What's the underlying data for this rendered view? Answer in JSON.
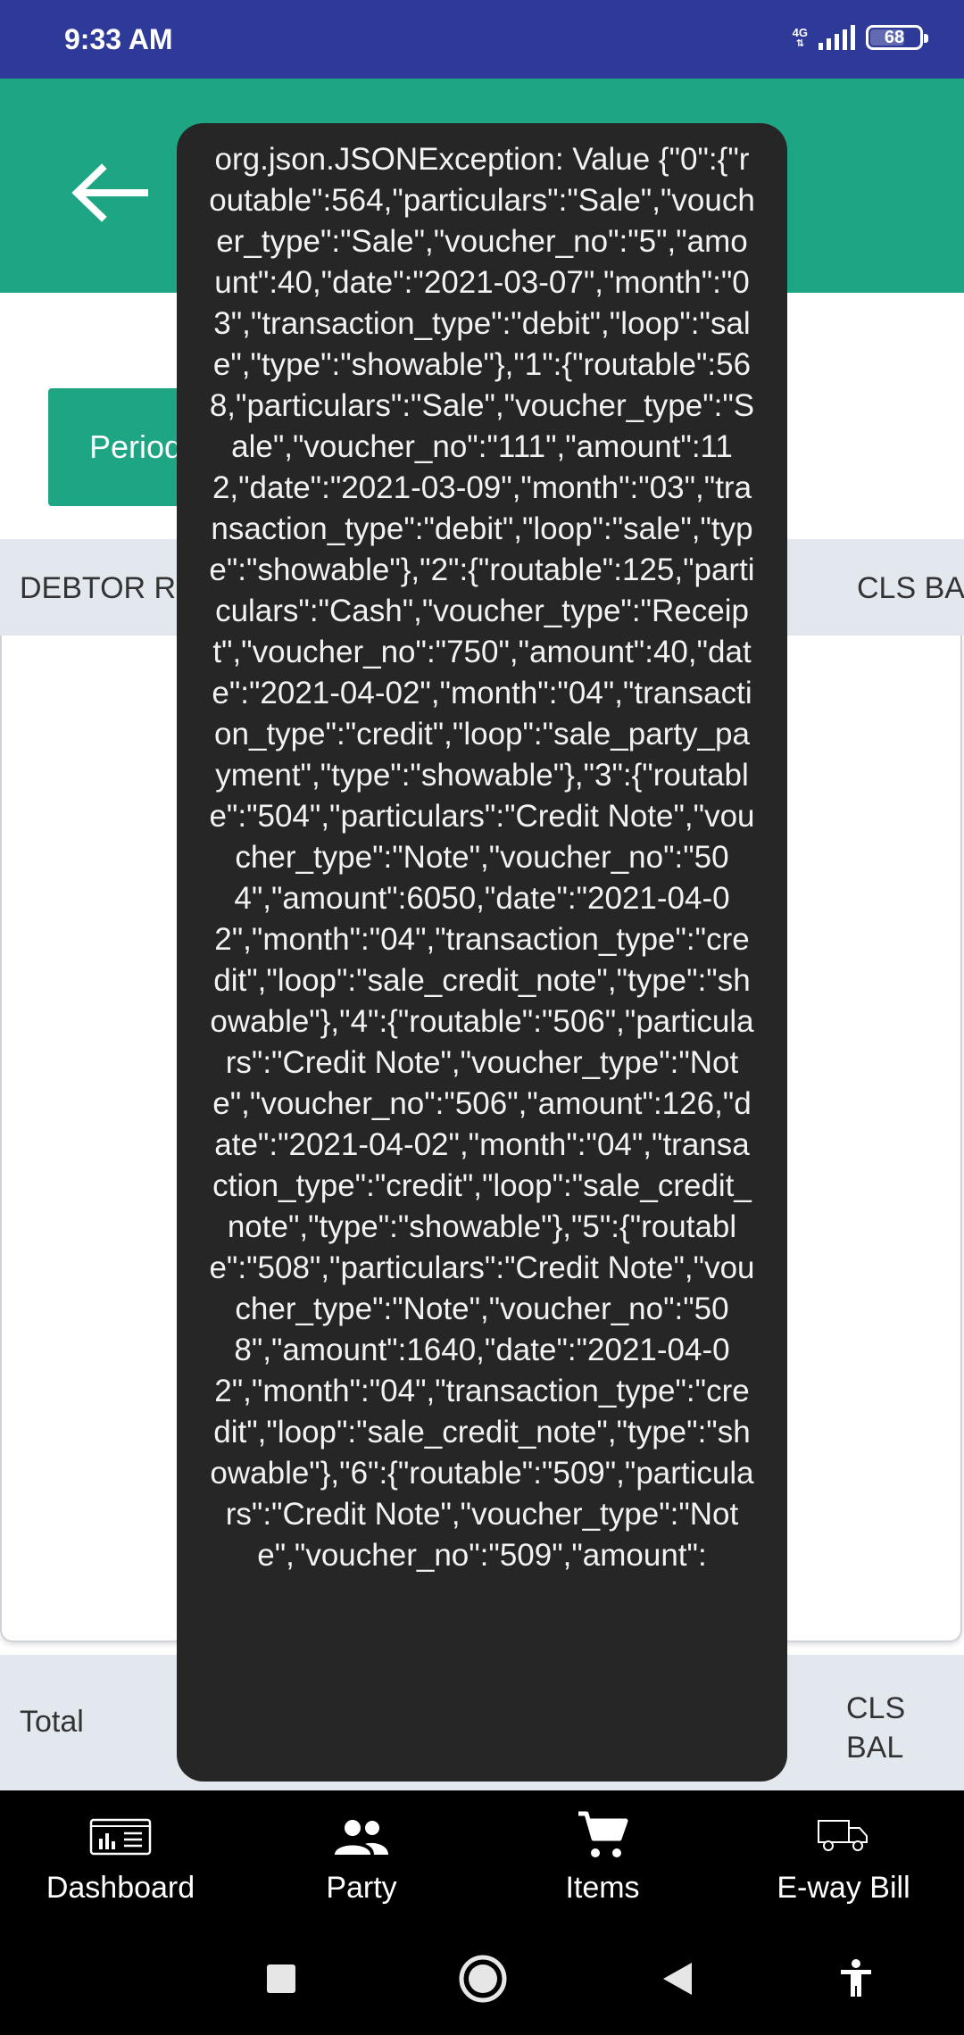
{
  "status_bar": {
    "time": "9:33 AM",
    "network": "4G",
    "battery": "68"
  },
  "screen": {
    "period_label": "Period",
    "columns": {
      "left": "DEBTOR R",
      "right": "CLS BA"
    },
    "totals": {
      "label": "Total",
      "cls": "CLS BAL"
    }
  },
  "toast": {
    "message": "org.json.JSONException: Value {\"0\":{\"routable\":564,\"particulars\":\"Sale\",\"voucher_type\":\"Sale\",\"voucher_no\":\"5\",\"amount\":40,\"date\":\"2021-03-07\",\"month\":\"03\",\"transaction_type\":\"debit\",\"loop\":\"sale\",\"type\":\"showable\"},\"1\":{\"routable\":568,\"particulars\":\"Sale\",\"voucher_type\":\"Sale\",\"voucher_no\":\"111\",\"amount\":112,\"date\":\"2021-03-09\",\"month\":\"03\",\"transaction_type\":\"debit\",\"loop\":\"sale\",\"type\":\"showable\"},\"2\":{\"routable\":125,\"particulars\":\"Cash\",\"voucher_type\":\"Receipt\",\"voucher_no\":\"750\",\"amount\":40,\"date\":\"2021-04-02\",\"month\":\"04\",\"transaction_type\":\"credit\",\"loop\":\"sale_party_payment\",\"type\":\"showable\"},\"3\":{\"routable\":\"504\",\"particulars\":\"Credit Note\",\"voucher_type\":\"Note\",\"voucher_no\":\"504\",\"amount\":6050,\"date\":\"2021-04-02\",\"month\":\"04\",\"transaction_type\":\"credit\",\"loop\":\"sale_credit_note\",\"type\":\"showable\"},\"4\":{\"routable\":\"506\",\"particulars\":\"Credit Note\",\"voucher_type\":\"Note\",\"voucher_no\":\"506\",\"amount\":126,\"date\":\"2021-04-02\",\"month\":\"04\",\"transaction_type\":\"credit\",\"loop\":\"sale_credit_note\",\"type\":\"showable\"},\"5\":{\"routable\":\"508\",\"particulars\":\"Credit Note\",\"voucher_type\":\"Note\",\"voucher_no\":\"508\",\"amount\":1640,\"date\":\"2021-04-02\",\"month\":\"04\",\"transaction_type\":\"credit\",\"loop\":\"sale_credit_note\",\"type\":\"showable\"},\"6\":{\"routable\":\"509\",\"particulars\":\"Credit Note\",\"voucher_type\":\"Note\",\"voucher_no\":\"509\",\"amount\":"
  },
  "bottom_nav": {
    "items": [
      {
        "label": "Dashboard",
        "icon": "dashboard-icon"
      },
      {
        "label": "Party",
        "icon": "people-icon"
      },
      {
        "label": "Items",
        "icon": "cart-icon"
      },
      {
        "label": "E-way Bill",
        "icon": "truck-icon"
      }
    ]
  },
  "colors": {
    "status_bar": "#2e3a97",
    "accent": "#1ea584",
    "header_bg": "#e3e7ee",
    "toast_bg": "#262626"
  }
}
